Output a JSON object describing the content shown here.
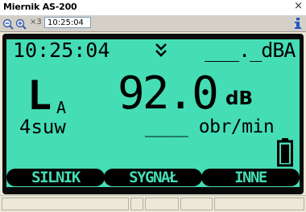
{
  "window": {
    "title": "Miernik AS-200",
    "close_glyph": "×"
  },
  "toolbar": {
    "zoom_out_icon": "zoom-out-icon",
    "zoom_in_icon": "zoom-in-icon",
    "zoom_level": "×3",
    "time": "10:25:04",
    "info_icon": "info-icon"
  },
  "lcd": {
    "time": "10:25:04",
    "indicator_icon": "double-chevron-down-icon",
    "dba_value": "___._",
    "dba_unit": "dBA",
    "mode_letter": "L",
    "mode_sub": "A",
    "main_value": "92.0",
    "main_unit": "dB",
    "range_label": "4suw",
    "rpm_value": "____",
    "rpm_unit": "obr/min",
    "battery_icon": "battery-icon",
    "softkeys": [
      "SILNIK",
      "SYGNAŁ",
      "INNE"
    ]
  },
  "colors": {
    "lcd": "#45ddb5",
    "frame": "#0a0a0a",
    "titlebar": "#ffffff",
    "chrome": "#d4d0c8"
  }
}
